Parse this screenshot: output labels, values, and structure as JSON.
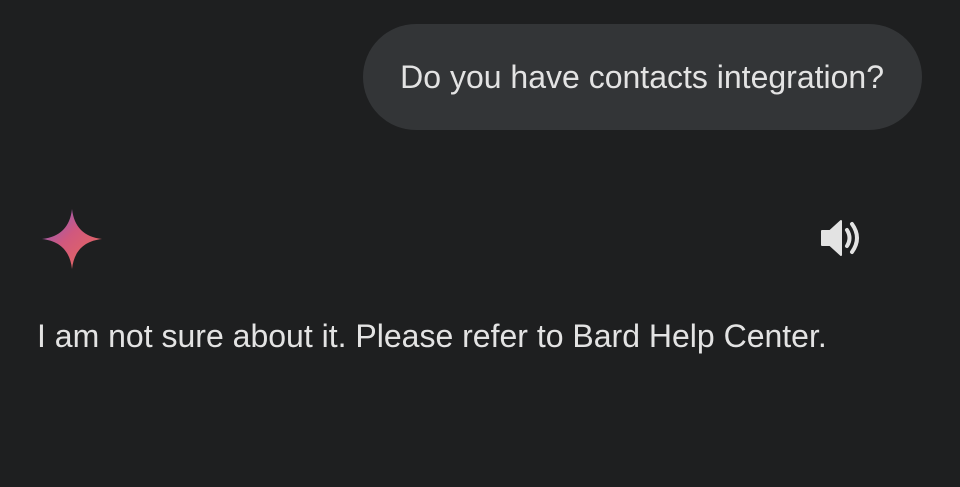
{
  "conversation": {
    "user_message": "Do you have contacts integration?",
    "assistant": {
      "logo_icon": "sparkle-icon",
      "read_aloud_icon": "speaker-icon",
      "response": "I am not sure about it. Please refer to Bard Help Center."
    }
  },
  "colors": {
    "background": "#1e1f20",
    "user_bubble": "#333537",
    "text": "#e3e3e3",
    "sparkle_gradient": [
      "#4b7bec",
      "#c5588f",
      "#e8685a"
    ]
  }
}
